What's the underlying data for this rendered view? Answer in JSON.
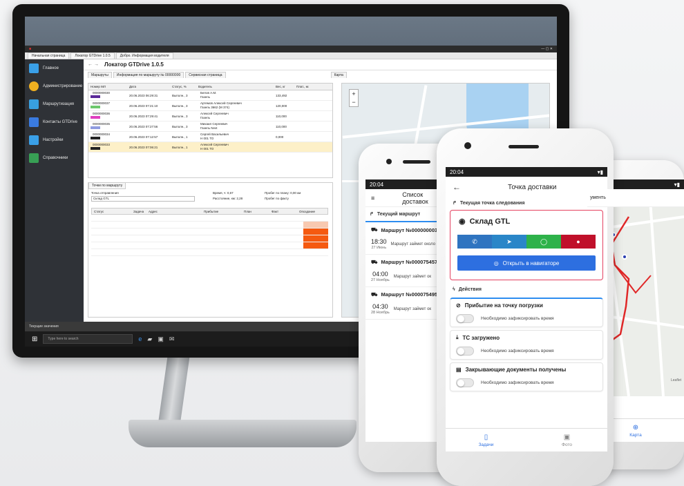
{
  "desktop": {
    "window_title": "",
    "browser_tabs": [
      "Начальная страница",
      "Локатор GTDrive 1.0.5",
      "Добро. Информация водителя"
    ],
    "sidebar": [
      {
        "label": "Главное",
        "color": "#3aa0e8"
      },
      {
        "label": "Администрирование",
        "color": "#f0b020"
      },
      {
        "label": "Маршрутизация",
        "color": "#38a0e0"
      },
      {
        "label": "Контакты GTDrive",
        "color": "#3a7be0"
      },
      {
        "label": "Настройки",
        "color": "#3aa0e8"
      },
      {
        "label": "Справочники",
        "color": "#38a055"
      }
    ],
    "page_title": "Локатор GTDrive 1.0.5",
    "sub_tabs": [
      "Маршруты",
      "Информация по маршруту № 00000000",
      "Сервисная страница"
    ],
    "map_tab": "Карта",
    "grid_headers": [
      "Номер МЛ",
      "Дата",
      "Статус, %",
      "Водитель",
      "Вес, кг",
      "Плат., кк"
    ],
    "grid_rows": [
      {
        "num": "0000000030",
        "date": "20.06.2023 06:29:31",
        "status": "Выполн., 3",
        "driver": "Белов А.М.",
        "vehicle": "Газель",
        "weight": "133,492",
        "color": "#5b2a99",
        "selected": false
      },
      {
        "num": "0000000037",
        "date": "20.06.2023 07:21:10",
        "status": "Выполн., 3",
        "driver": "Артемов Алексей Сергеевич",
        "vehicle": "Газель 3662 (М 374)",
        "weight": "120,000",
        "color": "#6cc86c",
        "selected": false
      },
      {
        "num": "0000000036",
        "date": "20.06.2023 07:29:41",
        "status": "Выполн., 3",
        "driver": "Алексей Сергеевич",
        "vehicle": "Газель",
        "weight": "110,000",
        "color": "#e03fc0",
        "selected": false
      },
      {
        "num": "0000000035",
        "date": "20.06.2023 07:27:56",
        "status": "Выполн., 3",
        "driver": "Михаил Сергеевич",
        "vehicle": "Газель Next",
        "weight": "110,000",
        "color": "#8f9be0",
        "selected": false
      },
      {
        "num": "0000000034",
        "date": "20.06.2023 07:12:57",
        "status": "Выполн., 1",
        "driver": "Сергей Васильевич",
        "vehicle": "Н 001 ТО",
        "weight": "0,000",
        "color": "#222222",
        "selected": false
      },
      {
        "num": "0000000033",
        "date": "20.06.2023 07:06:21",
        "status": "Выполн., 1",
        "driver": "Алексей Сергеевич",
        "vehicle": "Н 001 ТО",
        "weight": "",
        "color": "#222222",
        "selected": true
      }
    ],
    "lower_tab": "Точки по маршруту",
    "lower_field_label": "Точка отправления",
    "lower_field_value": "Склад GTL",
    "lower_stats": [
      "Время, ч: 0,67",
      "Пробег по плану: 0,00 км",
      "Расстояние, км: 2,28",
      "Пробег по факту"
    ],
    "lower_headers": [
      "Статус",
      "Задача",
      "Адрес",
      "Прибытие",
      "План",
      "Факт",
      "Опоздание"
    ],
    "statusbar": "Текущие значения",
    "search_placeholder": "Type here to search"
  },
  "phone_a": {
    "time": "20:04",
    "title": "Список доставок",
    "current_route_label": "Текущий маршрут",
    "routes": [
      {
        "title": "Маршрут №000000003",
        "time": "18:30",
        "date": "27 Июнь",
        "note": "Маршрут займет около 3",
        "active": true
      },
      {
        "title": "Маршрут №000075457",
        "time": "04:00",
        "date": "27 Ноябрь",
        "note": "Маршрут займет ок",
        "active": false
      },
      {
        "title": "Маршрут №000075495",
        "time": "04:30",
        "date": "28 Ноябрь",
        "note": "Маршрут займет ок",
        "active": false
      }
    ]
  },
  "phone_b": {
    "time": "20:04",
    "title": "Точка доставки",
    "current_point_label": "Текущая точка следования",
    "warehouse": "Склад GTL",
    "action_buttons": [
      {
        "icon": "phone-icon",
        "color": "#2f74c0"
      },
      {
        "icon": "telegram-icon",
        "color": "#2a86c8"
      },
      {
        "icon": "whatsapp-icon",
        "color": "#2eb24a"
      },
      {
        "icon": "alert-icon",
        "color": "#c0102a"
      }
    ],
    "navigator_button": "Открыть в навигаторе",
    "actions_label": "Действия",
    "actions": [
      {
        "title": "Прибытие на точку погрузки",
        "toggle_label": "Необходимо зафиксировать время",
        "highlight": true
      },
      {
        "title": "ТС загружено",
        "toggle_label": "Необходимо зафиксировать время",
        "highlight": false
      },
      {
        "title": "Закрывающие документы получены",
        "toggle_label": "Необходимо зафиксировать время",
        "highlight": false
      }
    ],
    "nav": {
      "tasks": "Задачи",
      "photo": "Фото"
    }
  },
  "phone_c": {
    "header_partial": "ументь",
    "nav_map": "Карта",
    "leaflet": "Leaflet"
  }
}
